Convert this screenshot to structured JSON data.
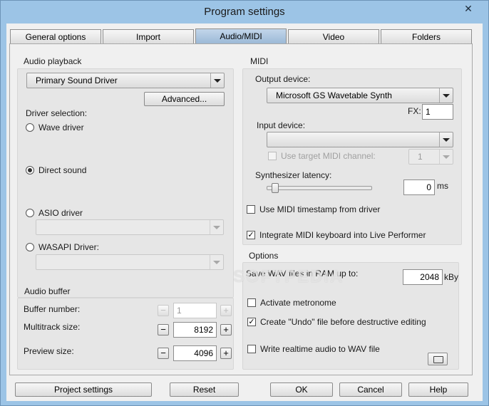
{
  "window": {
    "title": "Program settings",
    "close_glyph": "✕"
  },
  "tabs": [
    {
      "label": "General options",
      "active": false
    },
    {
      "label": "Import",
      "active": false
    },
    {
      "label": "Audio/MIDI",
      "active": true
    },
    {
      "label": "Video",
      "active": false
    },
    {
      "label": "Folders",
      "active": false
    }
  ],
  "audio_playback": {
    "title": "Audio playback",
    "device_value": "Primary Sound Driver",
    "advanced_label": "Advanced...",
    "driver_selection_label": "Driver selection:",
    "options": [
      {
        "label": "Wave driver",
        "selected": false
      },
      {
        "label": "Direct sound",
        "selected": true
      },
      {
        "label": "ASIO driver",
        "selected": false
      },
      {
        "label": "WASAPI Driver:",
        "selected": false
      }
    ]
  },
  "audio_buffer": {
    "title": "Audio buffer",
    "buffer_number_label": "Buffer number:",
    "buffer_number_value": "1",
    "multitrack_label": "Multitrack size:",
    "multitrack_value": "8192",
    "preview_label": "Preview size:",
    "preview_value": "4096",
    "minus": "−",
    "plus": "+"
  },
  "midi": {
    "title": "MIDI",
    "output_label": "Output device:",
    "output_value": "Microsoft GS Wavetable Synth",
    "fx_label": "FX:",
    "fx_value": "1",
    "input_label": "Input device:",
    "input_value": "",
    "use_target_label": "Use target MIDI channel:",
    "use_target_checked": false,
    "channel_value": "1",
    "latency_label": "Synthesizer latency:",
    "latency_value": "0",
    "latency_unit": "ms",
    "latency_level": 0.05,
    "timestamp_label": "Use MIDI timestamp from driver",
    "timestamp_checked": false,
    "integrate_label": "Integrate MIDI keyboard into Live Performer",
    "integrate_checked": true
  },
  "options": {
    "title": "Options",
    "save_wav_label": "Save WAV files in RAM up to:",
    "save_wav_value": "2048",
    "save_wav_unit": "kBy",
    "metronome_label": "Activate metronome",
    "metronome_checked": false,
    "undo_label": "Create \"Undo\" file before destructive editing",
    "undo_checked": true,
    "realtime_label": "Write realtime audio to WAV file",
    "realtime_checked": false
  },
  "footer": {
    "project_settings": "Project settings",
    "reset": "Reset",
    "ok": "OK",
    "cancel": "Cancel",
    "help": "Help"
  },
  "watermark": "SOFTPEDIA",
  "icons": {
    "close": "close-icon",
    "folder": "folder-icon",
    "dropdown": "chevron-down-icon"
  }
}
